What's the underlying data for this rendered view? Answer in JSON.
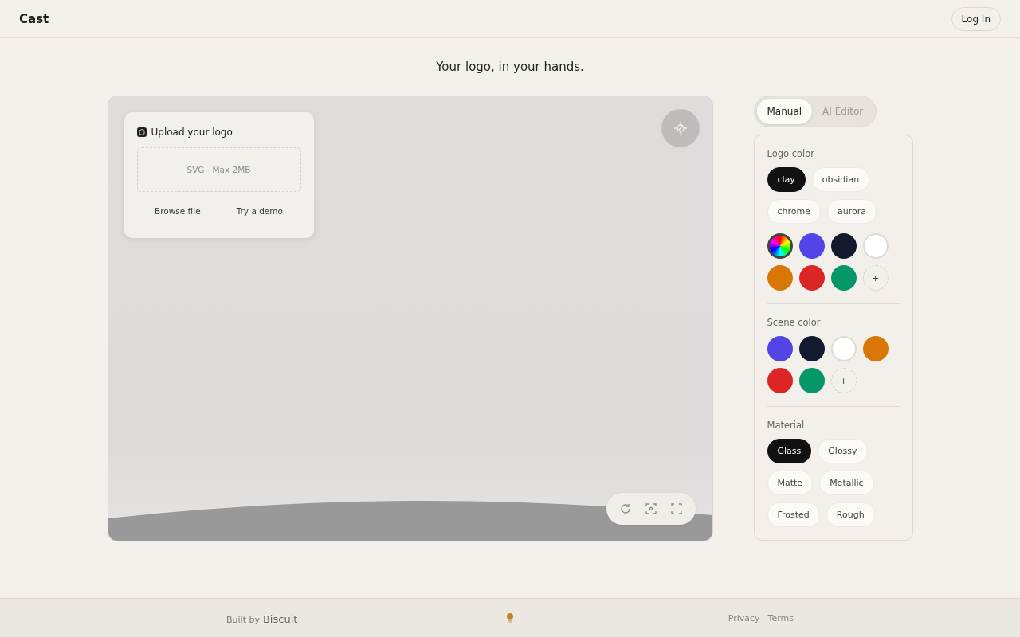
{
  "header": {
    "brand": "Cast",
    "login": "Log In"
  },
  "headline": "Your logo, in your hands.",
  "upload": {
    "title": "Upload your logo",
    "dropzone": "SVG · Max 2MB",
    "actions": [
      "Browse file",
      "Try a demo"
    ]
  },
  "tabs": [
    {
      "label": "Manual",
      "selected": true
    },
    {
      "label": "AI Editor",
      "selected": false
    }
  ],
  "logo_color": {
    "label": "Logo color",
    "presets": [
      {
        "label": "clay",
        "selected": true
      },
      {
        "label": "obsidian",
        "selected": false
      },
      {
        "label": "chrome",
        "selected": false
      },
      {
        "label": "aurora",
        "selected": false
      }
    ],
    "swatches": [
      {
        "kind": "picker",
        "selected": true
      },
      {
        "kind": "color",
        "color": "#5146e5",
        "selected": false
      },
      {
        "kind": "color",
        "color": "#111a2e",
        "selected": false
      },
      {
        "kind": "color",
        "color": "#ffffff",
        "selected": false
      },
      {
        "kind": "color",
        "color": "#d97706",
        "selected": false
      },
      {
        "kind": "color",
        "color": "#dc2626",
        "selected": false
      },
      {
        "kind": "color",
        "color": "#059669",
        "selected": false
      },
      {
        "kind": "add",
        "label": "+"
      }
    ]
  },
  "scene_color": {
    "label": "Scene color",
    "swatches": [
      {
        "kind": "color",
        "color": "#5146e5",
        "selected": false
      },
      {
        "kind": "color",
        "color": "#111a2e",
        "selected": false
      },
      {
        "kind": "color",
        "color": "#ffffff",
        "selected": false
      },
      {
        "kind": "color",
        "color": "#d97706",
        "selected": false
      },
      {
        "kind": "color",
        "color": "#dc2626",
        "selected": false
      },
      {
        "kind": "color",
        "color": "#059669",
        "selected": false
      },
      {
        "kind": "add",
        "label": "+"
      }
    ]
  },
  "material": {
    "label": "Material",
    "options": [
      {
        "label": "Glass",
        "selected": true
      },
      {
        "label": "Glossy",
        "selected": false
      },
      {
        "label": "Matte",
        "selected": false
      },
      {
        "label": "Metallic",
        "selected": false
      },
      {
        "label": "Frosted",
        "selected": false
      },
      {
        "label": "Rough",
        "selected": false
      }
    ]
  },
  "footer": {
    "built_by": "Built by",
    "brand": "Biscuit",
    "links": [
      "Privacy",
      "Terms"
    ]
  }
}
